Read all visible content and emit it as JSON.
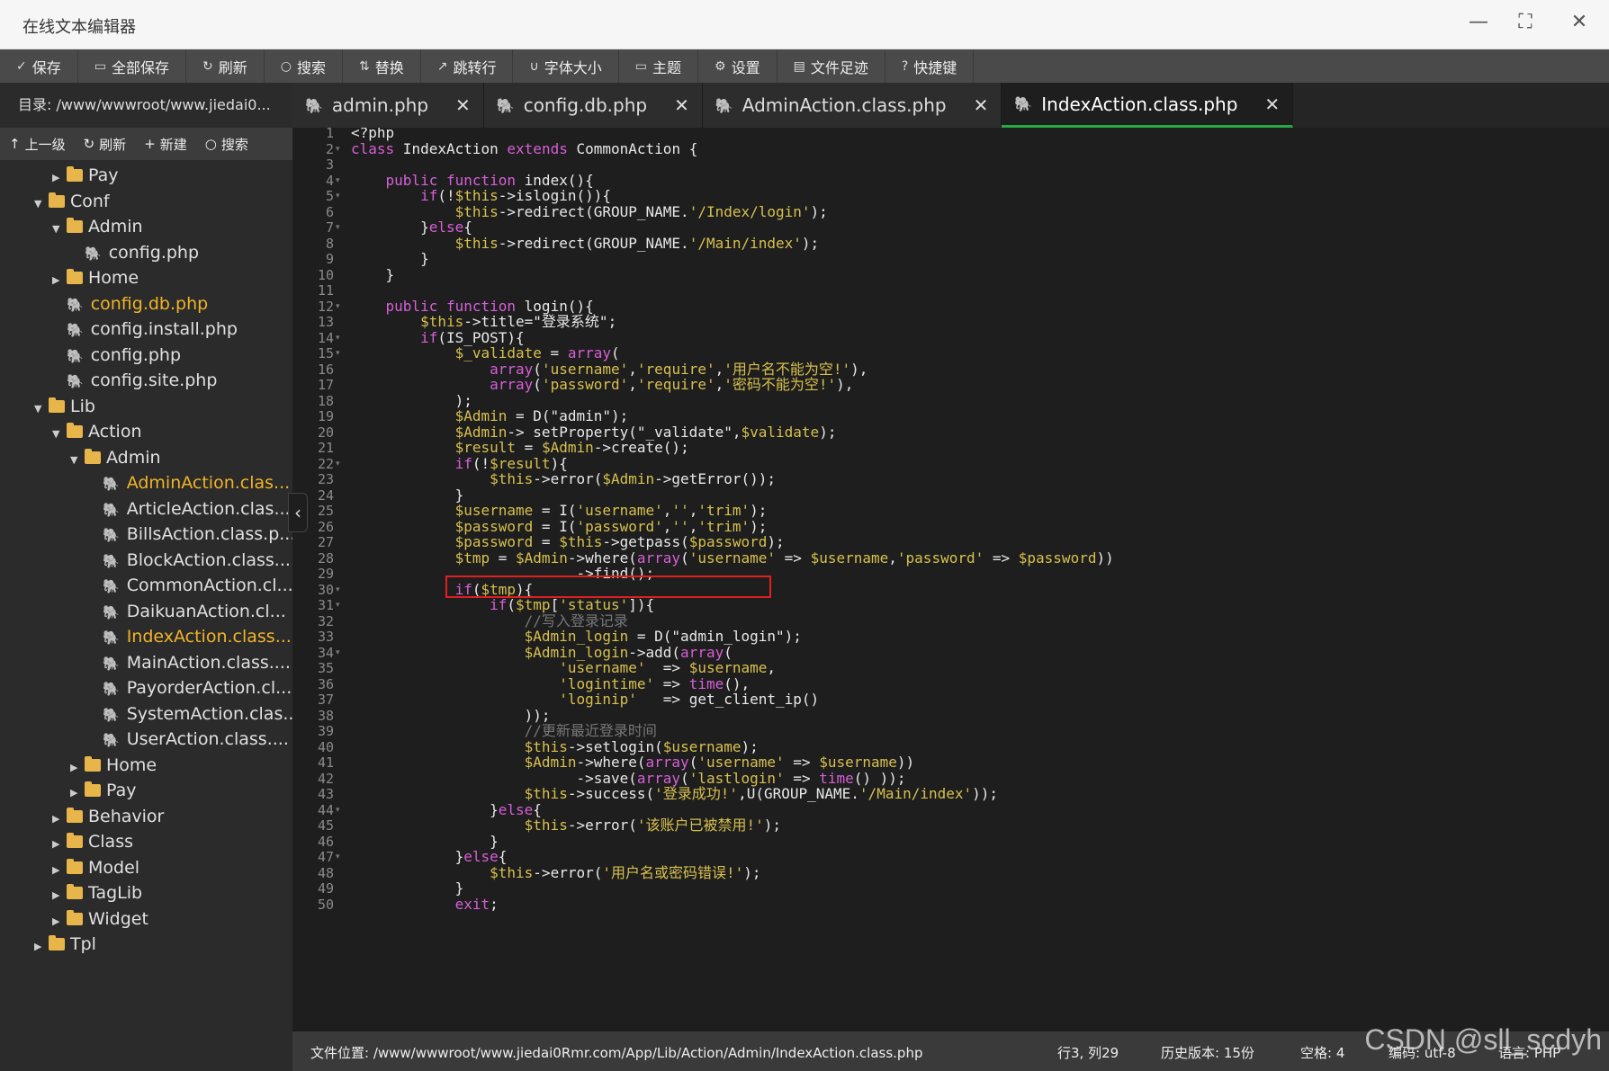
{
  "window": {
    "title": "在线文本编辑器",
    "min": "—",
    "max": "⛶",
    "close": "✕"
  },
  "toolbar": [
    {
      "icon": "check-icon",
      "glyph": "✓",
      "label": "保存"
    },
    {
      "icon": "save-all-icon",
      "glyph": "▭",
      "label": "全部保存"
    },
    {
      "icon": "refresh-icon",
      "glyph": "↻",
      "label": "刷新"
    },
    {
      "icon": "search-icon",
      "glyph": "○",
      "label": "搜索"
    },
    {
      "icon": "replace-icon",
      "glyph": "⇅",
      "label": "替换"
    },
    {
      "icon": "goto-line-icon",
      "glyph": "↗",
      "label": "跳转行"
    },
    {
      "icon": "font-size-icon",
      "glyph": "∪",
      "label": "字体大小"
    },
    {
      "icon": "theme-icon",
      "glyph": "▭",
      "label": "主题"
    },
    {
      "icon": "settings-icon",
      "glyph": "⚙",
      "label": "设置"
    },
    {
      "icon": "history-icon",
      "glyph": "▤",
      "label": "文件足迹"
    },
    {
      "icon": "shortcut-icon",
      "glyph": "?",
      "label": "快捷键"
    }
  ],
  "directory": {
    "label": "目录: /www/wwwroot/www.jiedai0..."
  },
  "tabs": [
    {
      "label": "admin.php",
      "close": "✕",
      "active": false
    },
    {
      "label": "config.db.php",
      "close": "✕",
      "active": false
    },
    {
      "label": "AdminAction.class.php",
      "close": "✕",
      "active": false
    },
    {
      "label": "IndexAction.class.php",
      "close": "✕",
      "active": true
    }
  ],
  "sidebar_tools": [
    {
      "icon": "up-icon",
      "glyph": "↑",
      "label": "上一级"
    },
    {
      "icon": "refresh-icon",
      "glyph": "↻",
      "label": "刷新"
    },
    {
      "icon": "plus-icon",
      "glyph": "+",
      "label": "新建"
    },
    {
      "icon": "search-icon",
      "glyph": "○",
      "label": "搜索"
    }
  ],
  "tree": [
    {
      "label": "Pay",
      "type": "folder",
      "depth": 1,
      "state": "closed"
    },
    {
      "label": "Conf",
      "type": "folder",
      "depth": 0,
      "state": "open"
    },
    {
      "label": "Admin",
      "type": "folder",
      "depth": 1,
      "state": "open"
    },
    {
      "label": "config.php",
      "type": "file",
      "depth": 2
    },
    {
      "label": "Home",
      "type": "folder",
      "depth": 1,
      "state": "closed"
    },
    {
      "label": "config.db.php",
      "type": "file",
      "depth": 1,
      "hl": true
    },
    {
      "label": "config.install.php",
      "type": "file",
      "depth": 1
    },
    {
      "label": "config.php",
      "type": "file",
      "depth": 1
    },
    {
      "label": "config.site.php",
      "type": "file",
      "depth": 1
    },
    {
      "label": "Lib",
      "type": "folder",
      "depth": 0,
      "state": "open"
    },
    {
      "label": "Action",
      "type": "folder",
      "depth": 1,
      "state": "open"
    },
    {
      "label": "Admin",
      "type": "folder",
      "depth": 2,
      "state": "open"
    },
    {
      "label": "AdminAction.clas...",
      "type": "file",
      "depth": 3,
      "hl": true
    },
    {
      "label": "ArticleAction.clas...",
      "type": "file",
      "depth": 3
    },
    {
      "label": "BillsAction.class.p...",
      "type": "file",
      "depth": 3
    },
    {
      "label": "BlockAction.class....",
      "type": "file",
      "depth": 3
    },
    {
      "label": "CommonAction.cl...",
      "type": "file",
      "depth": 3
    },
    {
      "label": "DaikuanAction.cl...",
      "type": "file",
      "depth": 3
    },
    {
      "label": "IndexAction.class....",
      "type": "file",
      "depth": 3,
      "hl": true
    },
    {
      "label": "MainAction.class....",
      "type": "file",
      "depth": 3
    },
    {
      "label": "PayorderAction.cl...",
      "type": "file",
      "depth": 3
    },
    {
      "label": "SystemAction.clas...",
      "type": "file",
      "depth": 3
    },
    {
      "label": "UserAction.class....",
      "type": "file",
      "depth": 3
    },
    {
      "label": "Home",
      "type": "folder",
      "depth": 2,
      "state": "closed"
    },
    {
      "label": "Pay",
      "type": "folder",
      "depth": 2,
      "state": "closed"
    },
    {
      "label": "Behavior",
      "type": "folder",
      "depth": 1,
      "state": "closed"
    },
    {
      "label": "Class",
      "type": "folder",
      "depth": 1,
      "state": "closed"
    },
    {
      "label": "Model",
      "type": "folder",
      "depth": 1,
      "state": "closed"
    },
    {
      "label": "TagLib",
      "type": "folder",
      "depth": 1,
      "state": "closed"
    },
    {
      "label": "Widget",
      "type": "folder",
      "depth": 1,
      "state": "closed"
    },
    {
      "label": "Tpl",
      "type": "folder",
      "depth": 0,
      "state": "closed"
    }
  ],
  "code_lines": [
    "<?php",
    "class IndexAction extends CommonAction {",
    "",
    "    public function index(){",
    "        if(!$this->islogin()){",
    "            $this->redirect(GROUP_NAME.'/Index/login');",
    "        }else{",
    "            $this->redirect(GROUP_NAME.'/Main/index');",
    "        }",
    "    }",
    "",
    "    public function login(){",
    "        $this->title=\"登录系统\";",
    "        if(IS_POST){",
    "            $_validate = array(",
    "                array('username','require','用户名不能为空!'),",
    "                array('password','require','密码不能为空!'),",
    "            );",
    "            $Admin = D(\"admin\");",
    "            $Admin-> setProperty(\"_validate\",$validate);",
    "            $result = $Admin->create();",
    "            if(!$result){",
    "                $this->error($Admin->getError());",
    "            }",
    "            $username = I('username','','trim');",
    "            $password = I('password','','trim');",
    "            $password = $this->getpass($password);",
    "            $tmp = $Admin->where(array('username' => $username,'password' => $password))",
    "                          ->find();",
    "            if($tmp){",
    "                if($tmp['status']){",
    "                    //写入登录记录",
    "                    $Admin_login = D(\"admin_login\");",
    "                    $Admin_login->add(array(",
    "                        'username'  => $username,",
    "                        'logintime' => time(),",
    "                        'loginip'   => get_client_ip()",
    "                    ));",
    "                    //更新最近登录时间",
    "                    $this->setlogin($username);",
    "                    $Admin->where(array('username' => $username))",
    "                          ->save(array('lastlogin' => time() ));",
    "                    $this->success('登录成功!',U(GROUP_NAME.'/Main/index'));",
    "                }else{",
    "                    $this->error('该账户已被禁用!');",
    "                }",
    "            }else{",
    "                $this->error('用户名或密码错误!');",
    "            }",
    "            exit;"
  ],
  "fold_lines": [
    2,
    4,
    5,
    7,
    12,
    14,
    15,
    22,
    30,
    31,
    34,
    44,
    47
  ],
  "status": {
    "file_path": "文件位置: /www/wwwroot/www.jiedai0Rmr.com/App/Lib/Action/Admin/IndexAction.class.php",
    "cursor": "行3, 列29",
    "history": "历史版本: 15份",
    "spaces": "空格: 4",
    "encoding": "编码: utf-8",
    "language": "语言: PHP"
  },
  "watermark": "CSDN @sll_scdyh"
}
